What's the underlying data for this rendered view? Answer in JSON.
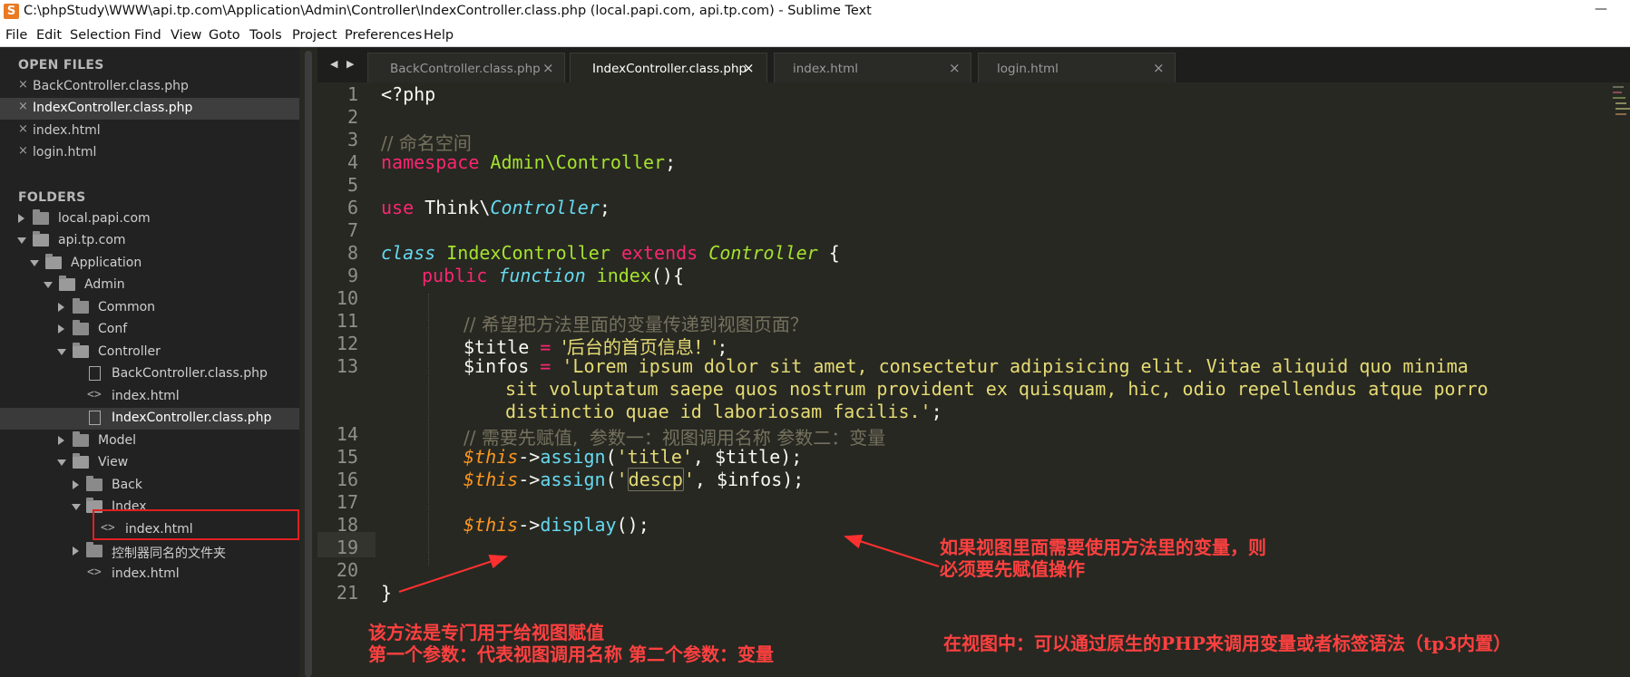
{
  "window": {
    "title": "C:\\phpStudy\\WWW\\api.tp.com\\Application\\Admin\\Controller\\IndexController.class.php (local.papi.com, api.tp.com) - Sublime Text",
    "minimize_glyph": "—"
  },
  "menu": [
    "File",
    "Edit",
    "Selection",
    "Find",
    "View",
    "Goto",
    "Tools",
    "Project",
    "Preferences",
    "Help"
  ],
  "sidebar": {
    "open_files_heading": "OPEN FILES",
    "open_files": [
      "BackController.class.php",
      "IndexController.class.php",
      "index.html",
      "login.html"
    ],
    "folders_heading": "FOLDERS",
    "tree": [
      {
        "label": "local.papi.com",
        "type": "folder"
      },
      {
        "label": "api.tp.com",
        "type": "folder",
        "open": true
      },
      {
        "label": "Application",
        "type": "folder",
        "open": true
      },
      {
        "label": "Admin",
        "type": "folder",
        "open": true
      },
      {
        "label": "Common",
        "type": "folder"
      },
      {
        "label": "Conf",
        "type": "folder"
      },
      {
        "label": "Controller",
        "type": "folder",
        "open": true
      },
      {
        "label": "BackController.class.php",
        "type": "file"
      },
      {
        "label": "index.html",
        "type": "code"
      },
      {
        "label": "IndexController.class.php",
        "type": "file",
        "selected": true
      },
      {
        "label": "Model",
        "type": "folder"
      },
      {
        "label": "View",
        "type": "folder",
        "open": true
      },
      {
        "label": "Back",
        "type": "folder"
      },
      {
        "label": "Index",
        "type": "folder",
        "open": true
      },
      {
        "label": "index.html",
        "type": "code"
      },
      {
        "label": "控制器同名的文件夹",
        "type": "folder"
      },
      {
        "label": "index.html",
        "type": "code"
      }
    ]
  },
  "tabs": [
    {
      "label": "BackController.class.php",
      "active": false
    },
    {
      "label": "IndexController.class.php",
      "active": true
    },
    {
      "label": "index.html",
      "active": false
    },
    {
      "label": "login.html",
      "active": false
    }
  ],
  "tab_close_glyph": "×",
  "line_numbers": [
    "1",
    "2",
    "3",
    "4",
    "5",
    "6",
    "7",
    "8",
    "9",
    "10",
    "11",
    "12",
    "13",
    "14",
    "15",
    "16",
    "17",
    "18",
    "19",
    "20",
    "21"
  ],
  "code": {
    "l1": "<?php",
    "l3": "// 命名空间",
    "l4_kw": "namespace",
    "l4_ns": "Admin\\Controller",
    "l4_end": ";",
    "l6_kw": "use",
    "l6_ns": "Think\\",
    "l6_cls": "Controller",
    "l6_end": ";",
    "l8_class": "class",
    "l8_name": "IndexController",
    "l8_extends": "extends",
    "l8_parent": "Controller",
    "l8_brace": " {",
    "l9_public": "public",
    "l9_function": "function",
    "l9_name": "index",
    "l9_rest": "(){",
    "l11": "// 希望把方法里面的变量传递到视图页面？",
    "l12_var": "$title",
    "l12_eq": " = ",
    "l12_str": "'后台的首页信息！'",
    "l12_end": ";",
    "l13_var": "$infos",
    "l13_eq": " = ",
    "l13_str1": "'Lorem ipsum dolor sit amet, consectetur adipisicing elit. Vitae aliquid quo minima",
    "l13_str2": "sit voluptatum saepe quos nostrum provident ex quisquam, hic, odio repellendus atque porro",
    "l13_str3": "distinctio quae id laboriosam facilis.'",
    "l13_end": ";",
    "l14": "// 需要先赋值,  参数一：视图调用名称 参数二：变量",
    "this": "$this",
    "arrow": "->",
    "assign": "assign",
    "l15_arg": "'title'",
    "l15_rest": ", $title);",
    "l16_q1": "'",
    "l16_arg": "descp",
    "l16_q2": "'",
    "l16_rest": ", $infos);",
    "display": "display",
    "l18_rest": "();",
    "l21": "}"
  },
  "annotations": {
    "right_1": "如果视图里面需要使用方法里的变量，则",
    "right_2": "必须要先赋值操作",
    "left_1": "该方法是专门用于给视图赋值",
    "left_2": "第一个参数：代表视图调用名称  第二个参数：变量",
    "bottom_right": "在视图中：可以通过原生的PHP来调用变量或者标签语法（tp3内置）"
  },
  "colors": {
    "editor_bg": "#272822",
    "sidebar_bg": "#222222",
    "keyword": "#f92672",
    "storage": "#66d9ef",
    "class_name": "#a6e22e",
    "string": "#e6db74",
    "comment": "#75715e",
    "variable_this": "#fd971f",
    "annotation": "#ff4040"
  }
}
